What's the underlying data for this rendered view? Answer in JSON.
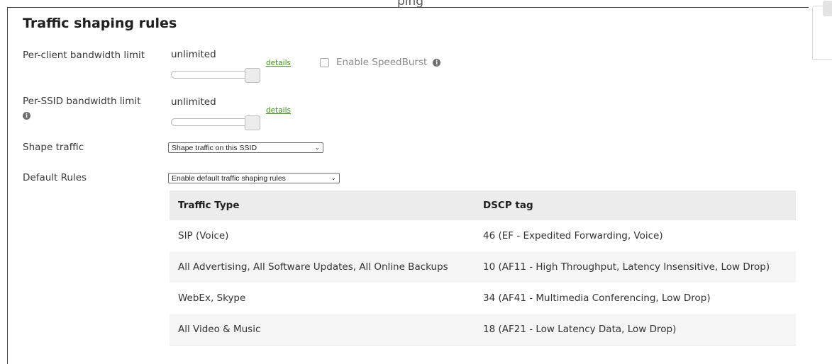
{
  "page_header_fragment": "ping",
  "section_title": "Traffic shaping rules",
  "per_client": {
    "label": "Per-client bandwidth limit",
    "value": "unlimited",
    "details_label": "details",
    "speedburst_label": "Enable SpeedBurst",
    "speedburst_checked": false
  },
  "per_ssid": {
    "label": "Per-SSID bandwidth limit",
    "value": "unlimited",
    "details_label": "details"
  },
  "shape_traffic": {
    "label": "Shape traffic",
    "selected": "Shape traffic on this SSID"
  },
  "default_rules": {
    "label": "Default Rules",
    "selected": "Enable default traffic shaping rules"
  },
  "rules_table": {
    "headers": [
      "Traffic Type",
      "DSCP tag"
    ],
    "rows": [
      {
        "traffic_type": "SIP (Voice)",
        "dscp": "46 (EF - Expedited Forwarding, Voice)"
      },
      {
        "traffic_type": "All Advertising, All Software Updates, All Online Backups",
        "dscp": "10 (AF11 - High Throughput, Latency Insensitive, Low Drop)"
      },
      {
        "traffic_type": "WebEx, Skype",
        "dscp": "34 (AF41 - Multimedia Conferencing, Low Drop)"
      },
      {
        "traffic_type": "All Video & Music",
        "dscp": "18 (AF21 - Low Latency Data, Low Drop)"
      }
    ]
  },
  "colors": {
    "link": "#3f8f1b",
    "header_bg": "#ececec",
    "row_alt_bg": "#f5f5f5"
  }
}
